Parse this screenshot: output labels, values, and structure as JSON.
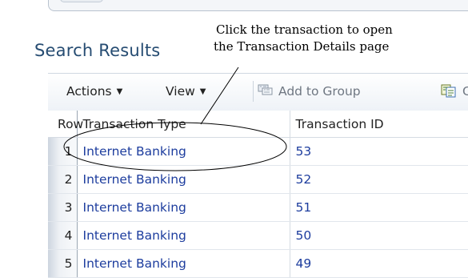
{
  "page": {
    "section_title": "Search Results",
    "callout_line1": "Click the transaction to open",
    "callout_line2": "the Transaction Details page"
  },
  "toolbar": {
    "actions_label": "Actions",
    "view_label": "View",
    "add_to_group_label": "Add to Group",
    "copy_label_visible": "Co"
  },
  "table": {
    "headers": {
      "row": "Row",
      "transaction_type": "Transaction Type",
      "transaction_id": "Transaction ID"
    },
    "rows": [
      {
        "row": "1",
        "transaction_type": "Internet Banking",
        "transaction_id": "53"
      },
      {
        "row": "2",
        "transaction_type": "Internet Banking",
        "transaction_id": "52"
      },
      {
        "row": "3",
        "transaction_type": "Internet Banking",
        "transaction_id": "51"
      },
      {
        "row": "4",
        "transaction_type": "Internet Banking",
        "transaction_id": "50"
      },
      {
        "row": "5",
        "transaction_type": "Internet Banking",
        "transaction_id": "49"
      }
    ]
  },
  "icons": {
    "add_to_group": "add-to-group-icon",
    "copy": "copy-icon",
    "caret": "chevron-down-icon"
  },
  "colors": {
    "title": "#264c72",
    "link": "#1d3d9e",
    "toolbar_text": "#222222",
    "disabled_text": "#6f7782"
  }
}
